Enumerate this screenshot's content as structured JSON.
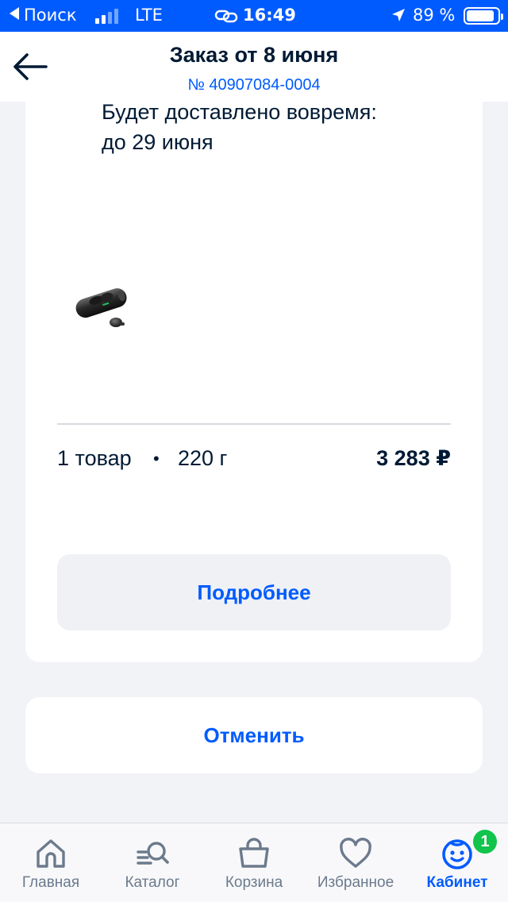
{
  "status_bar": {
    "back_app": "Поиск",
    "network": "LTE",
    "time": "16:49",
    "battery": "89 %",
    "battery_level": 0.89
  },
  "header": {
    "title": "Заказ от 8 июня",
    "order_number": "№ 40907084-0004"
  },
  "order": {
    "delivery_line1": "Будет доставлено вовремя:",
    "delivery_line2": "до 29 июня",
    "item_count": "1 товар",
    "separator": "•",
    "weight": "220 г",
    "price": "3 283 ₽",
    "details_button": "Подробнее"
  },
  "cancel_button": "Отменить",
  "tab_bar": {
    "tabs": [
      {
        "label": "Главная",
        "icon": "home-icon"
      },
      {
        "label": "Каталог",
        "icon": "catalog-search-icon"
      },
      {
        "label": "Корзина",
        "icon": "basket-icon"
      },
      {
        "label": "Избранное",
        "icon": "heart-icon"
      },
      {
        "label": "Кабинет",
        "icon": "smiley-face-icon",
        "active": true,
        "badge": "1"
      }
    ]
  },
  "colors": {
    "accent": "#005bff",
    "text": "#001a34",
    "badge": "#10c44c",
    "background": "#f2f3f7"
  }
}
